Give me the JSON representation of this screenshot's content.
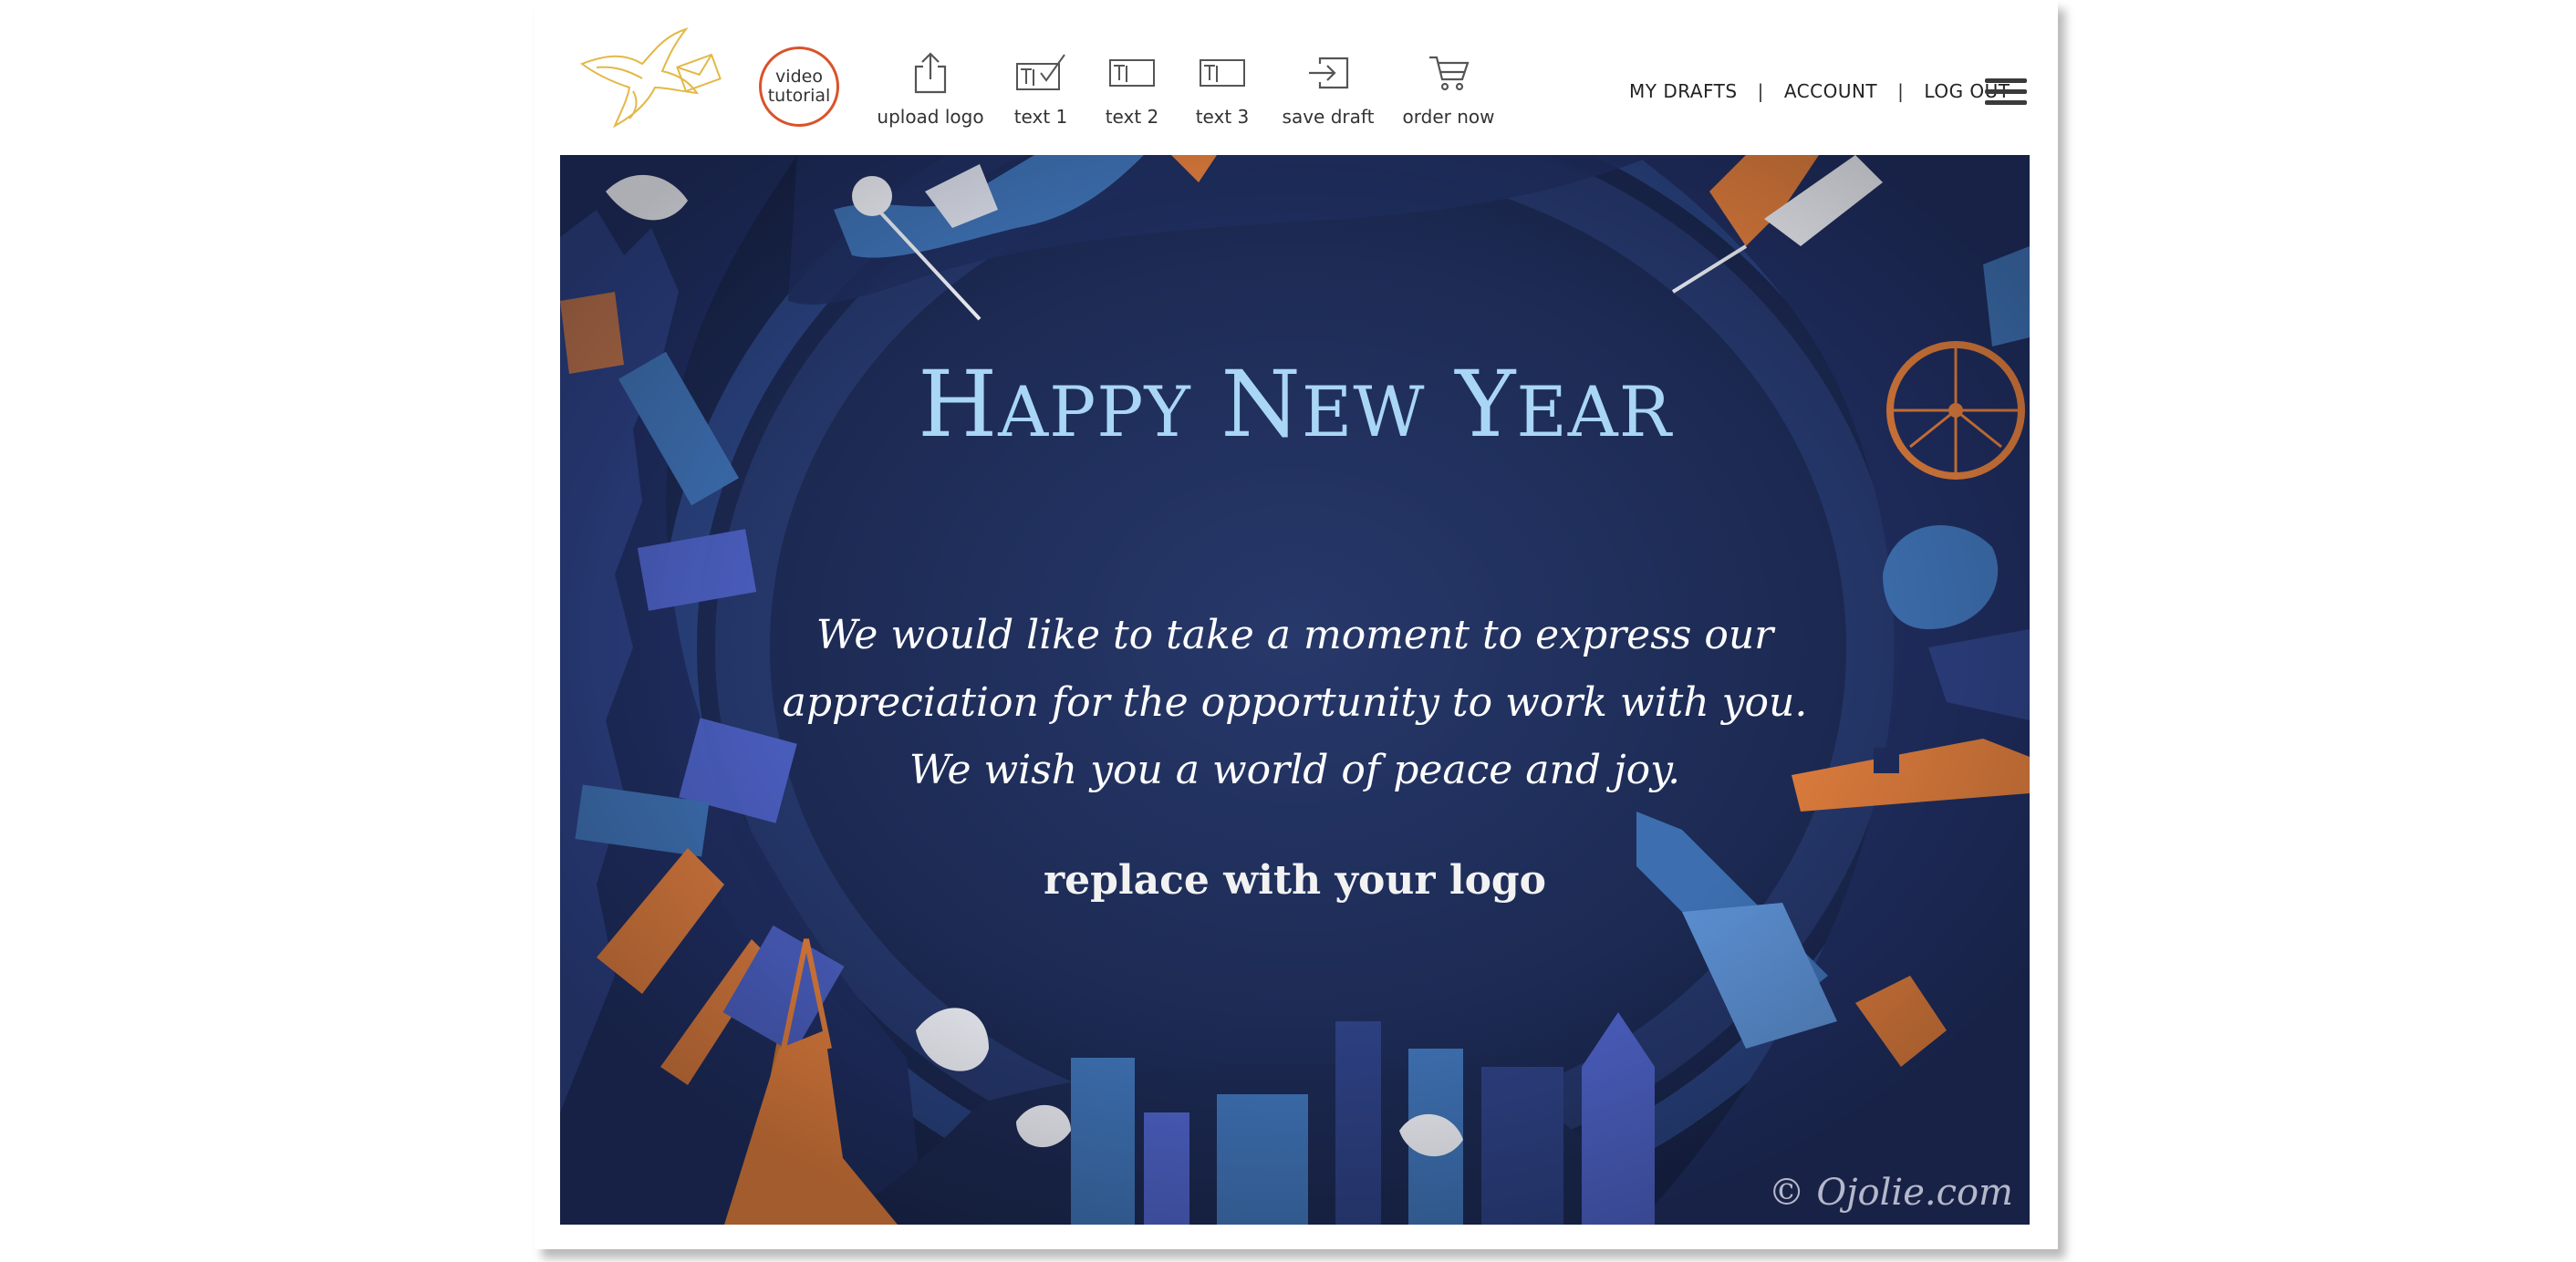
{
  "toolbar": {
    "video_button": {
      "line1": "video",
      "line2": "tutorial"
    },
    "tools": [
      {
        "label": "upload logo",
        "icon": "upload-icon"
      },
      {
        "label": "text 1",
        "icon": "text-edit-check-icon"
      },
      {
        "label": "text 2",
        "icon": "text-box-icon"
      },
      {
        "label": "text 3",
        "icon": "text-box-icon"
      },
      {
        "label": "save draft",
        "icon": "save-arrow-icon"
      },
      {
        "label": "order now",
        "icon": "cart-icon"
      }
    ]
  },
  "nav": {
    "my_drafts": "MY DRAFTS",
    "separator": "|",
    "account": "ACCOUNT",
    "log_out": "LOG OUT",
    "menu_icon": "hamburger-menu-icon"
  },
  "card": {
    "headline": {
      "h": "H",
      "appy": "APPY",
      "n": "N",
      "ew": "EW",
      "y": "Y",
      "ear": "EAR"
    },
    "message": {
      "line1": "We would like to take a moment to express our",
      "line2": "appreciation for the opportunity to work with you.",
      "line3": "We wish you a world of peace and joy."
    },
    "logo_placeholder": "replace with your logo",
    "watermark": "© Ojolie.com"
  },
  "colors": {
    "accent_red": "#d9532b",
    "headline_blue": "#a9d6f5",
    "card_navy": "#1d2b55",
    "city_orange": "#d97a3c",
    "city_blue": "#3d6fb0",
    "city_periwinkle": "#4b5fc0"
  }
}
